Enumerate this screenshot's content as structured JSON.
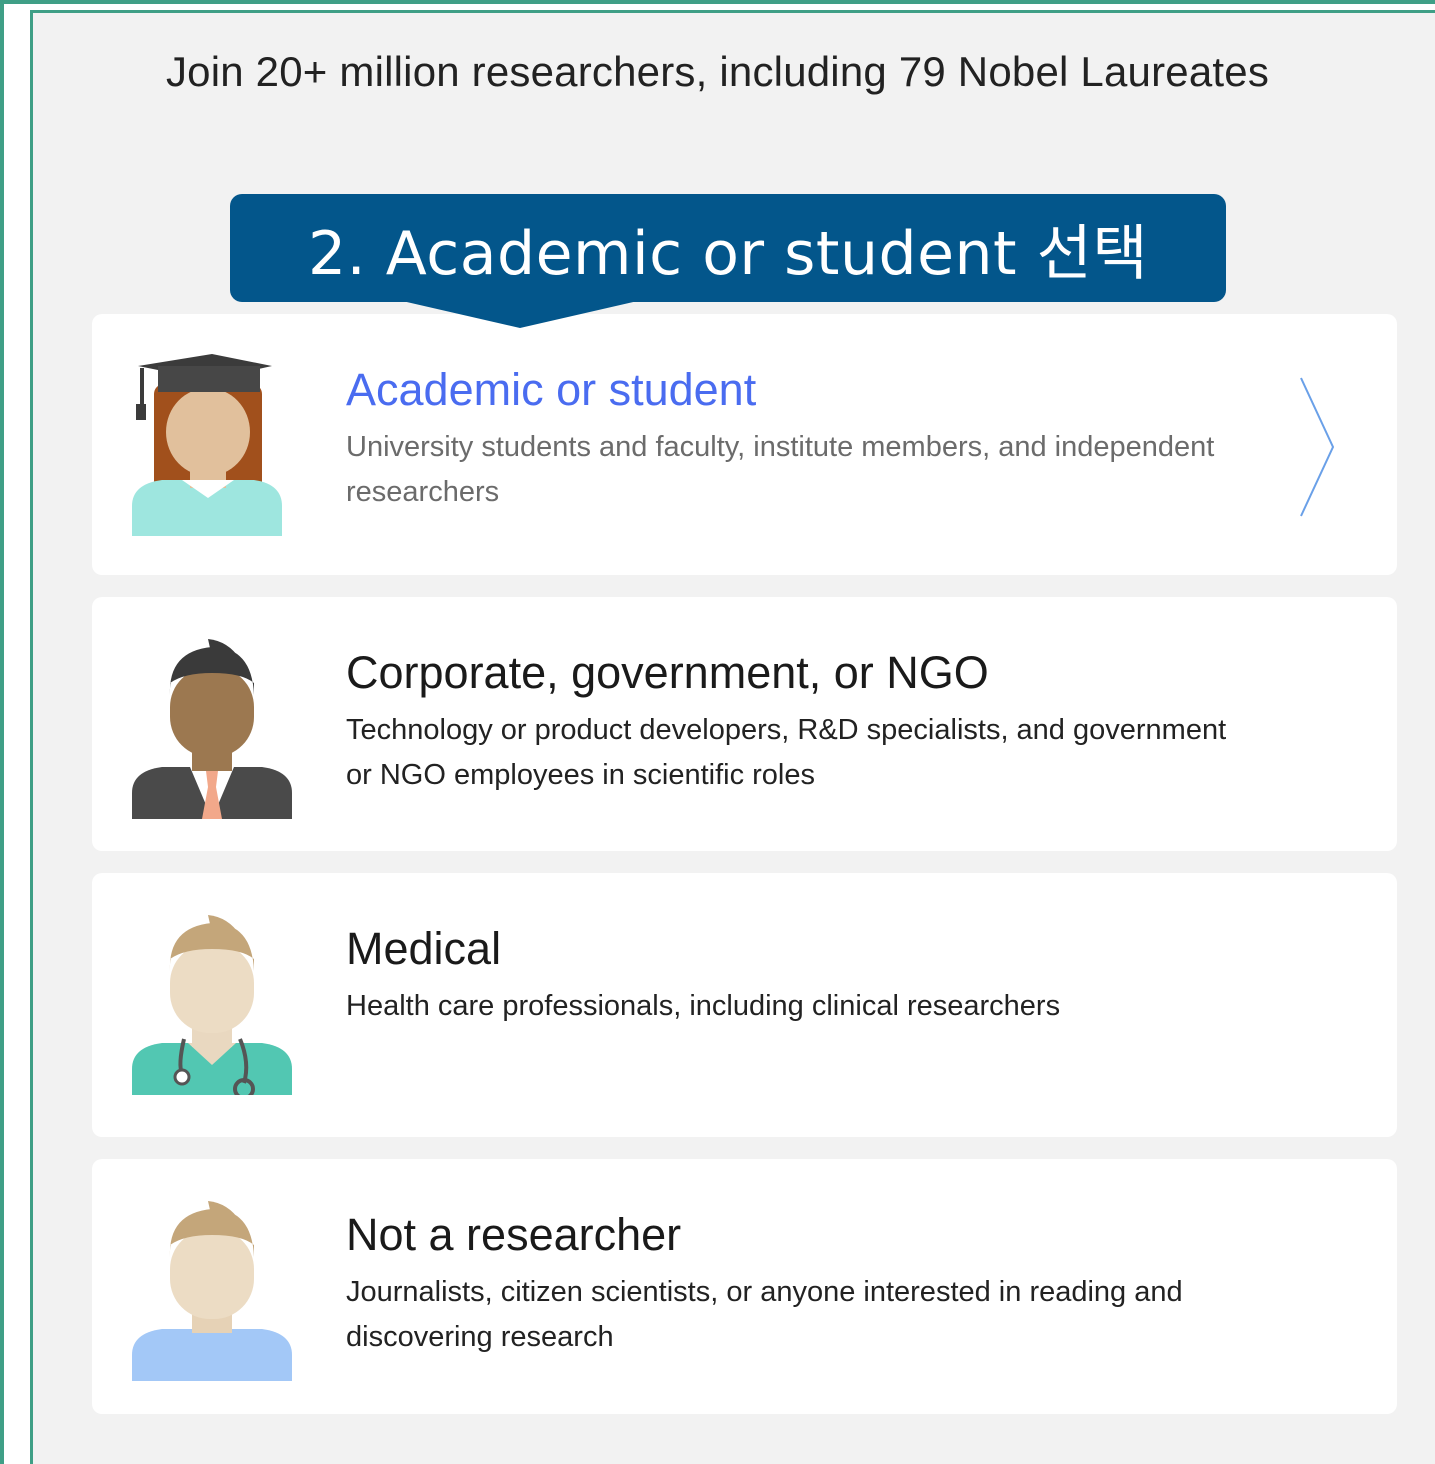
{
  "header": {
    "tagline": "Join 20+ million researchers, including 79 Nobel Laureates"
  },
  "callout": {
    "text": "2. Academic or student 선택"
  },
  "options": [
    {
      "title": "Academic or student",
      "description": "University students and faculty, institute members, and independent researchers",
      "icon": "academic-avatar-icon",
      "highlighted": true
    },
    {
      "title": "Corporate, government, or NGO",
      "description": "Technology or product developers, R&D specialists, and government or NGO employees in scientific roles",
      "icon": "corporate-avatar-icon",
      "highlighted": false
    },
    {
      "title": "Medical",
      "description": "Health care professionals, including clinical researchers",
      "icon": "medical-avatar-icon",
      "highlighted": false
    },
    {
      "title": "Not a researcher",
      "description": "Journalists, citizen scientists, or anyone interested in reading and discovering research",
      "icon": "non-researcher-avatar-icon",
      "highlighted": false
    }
  ],
  "colors": {
    "frame_border": "#3f9f86",
    "panel_bg": "#f2f2f2",
    "callout_bg": "#03568b",
    "highlight_title": "#4a6cf0",
    "chevron": "#6aa0e8"
  }
}
